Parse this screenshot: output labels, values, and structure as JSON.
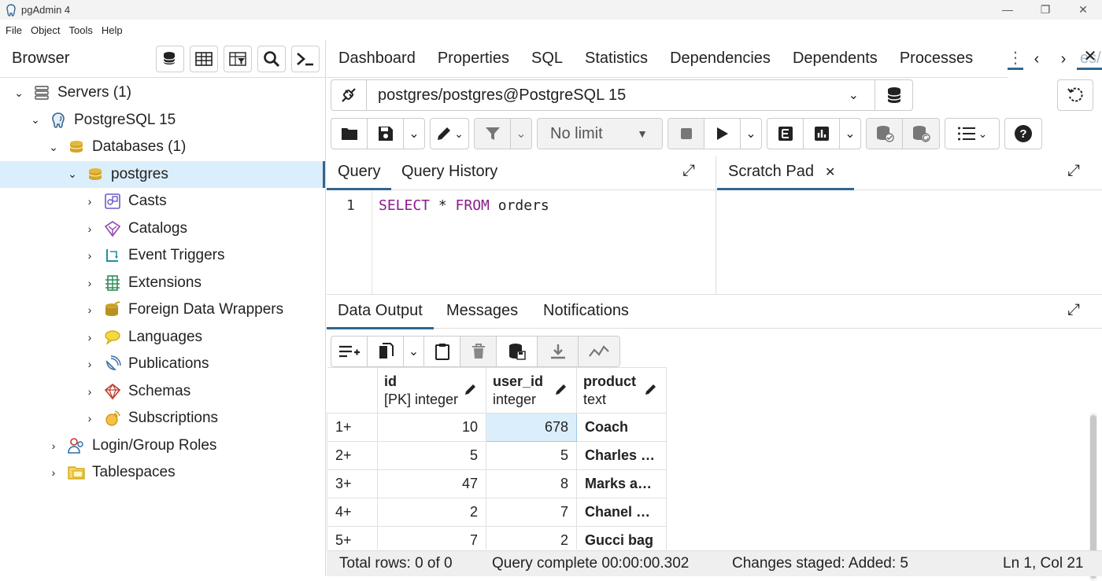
{
  "window": {
    "title": "pgAdmin 4",
    "minimize": "—",
    "restore": "❐",
    "close": "✕"
  },
  "menu": [
    "File",
    "Object",
    "Tools",
    "Help"
  ],
  "browser": {
    "title": "Browser",
    "tree": [
      {
        "label": "Servers (1)",
        "icon": "servers-icon"
      },
      {
        "label": "PostgreSQL 15",
        "icon": "postgres-elephant-icon"
      },
      {
        "label": "Databases (1)",
        "icon": "databases-icon"
      },
      {
        "label": "postgres",
        "icon": "database-icon"
      },
      {
        "label": "Casts",
        "icon": "casts-icon"
      },
      {
        "label": "Catalogs",
        "icon": "catalogs-icon"
      },
      {
        "label": "Event Triggers",
        "icon": "event-triggers-icon"
      },
      {
        "label": "Extensions",
        "icon": "extensions-icon"
      },
      {
        "label": "Foreign Data Wrappers",
        "icon": "fdw-icon"
      },
      {
        "label": "Languages",
        "icon": "languages-icon"
      },
      {
        "label": "Publications",
        "icon": "publications-icon"
      },
      {
        "label": "Schemas",
        "icon": "schemas-icon"
      },
      {
        "label": "Subscriptions",
        "icon": "subscriptions-icon"
      },
      {
        "label": "Login/Group Roles",
        "icon": "roles-icon"
      },
      {
        "label": "Tablespaces",
        "icon": "tablespaces-icon"
      }
    ]
  },
  "tabs": [
    "Dashboard",
    "Properties",
    "SQL",
    "Statistics",
    "Dependencies",
    "Dependents",
    "Processes"
  ],
  "partial_tab": "es/p",
  "connection": {
    "value": "postgres/postgres@PostgreSQL 15"
  },
  "toolbar": {
    "limit": "No limit"
  },
  "query_tabs": {
    "query": "Query",
    "history": "Query History",
    "scratch": "Scratch Pad",
    "scratch_close": "✕"
  },
  "editor": {
    "line": "1",
    "kw1": "SELECT",
    "mid": " * ",
    "kw2": "FROM",
    "rest": " orders"
  },
  "output_tabs": {
    "data": "Data Output",
    "messages": "Messages",
    "notifications": "Notifications"
  },
  "grid": {
    "columns": [
      {
        "name": "id",
        "type": "[PK] integer"
      },
      {
        "name": "user_id",
        "type": "integer"
      },
      {
        "name": "product",
        "type": "text"
      }
    ],
    "rows": [
      {
        "rn": "1+",
        "id": "10",
        "user_id": "678",
        "product": "Coach"
      },
      {
        "rn": "2+",
        "id": "5",
        "user_id": "5",
        "product": "Charles a..."
      },
      {
        "rn": "3+",
        "id": "47",
        "user_id": "8",
        "product": "Marks an..."
      },
      {
        "rn": "4+",
        "id": "2",
        "user_id": "7",
        "product": "Chanel bag"
      },
      {
        "rn": "5+",
        "id": "7",
        "user_id": "2",
        "product": "Gucci bag"
      }
    ]
  },
  "status": {
    "rows": "Total rows: 0 of 0",
    "query": "Query complete 00:00:00.302",
    "staged": "Changes staged: Added: 5",
    "cursor": "Ln 1, Col 21"
  }
}
